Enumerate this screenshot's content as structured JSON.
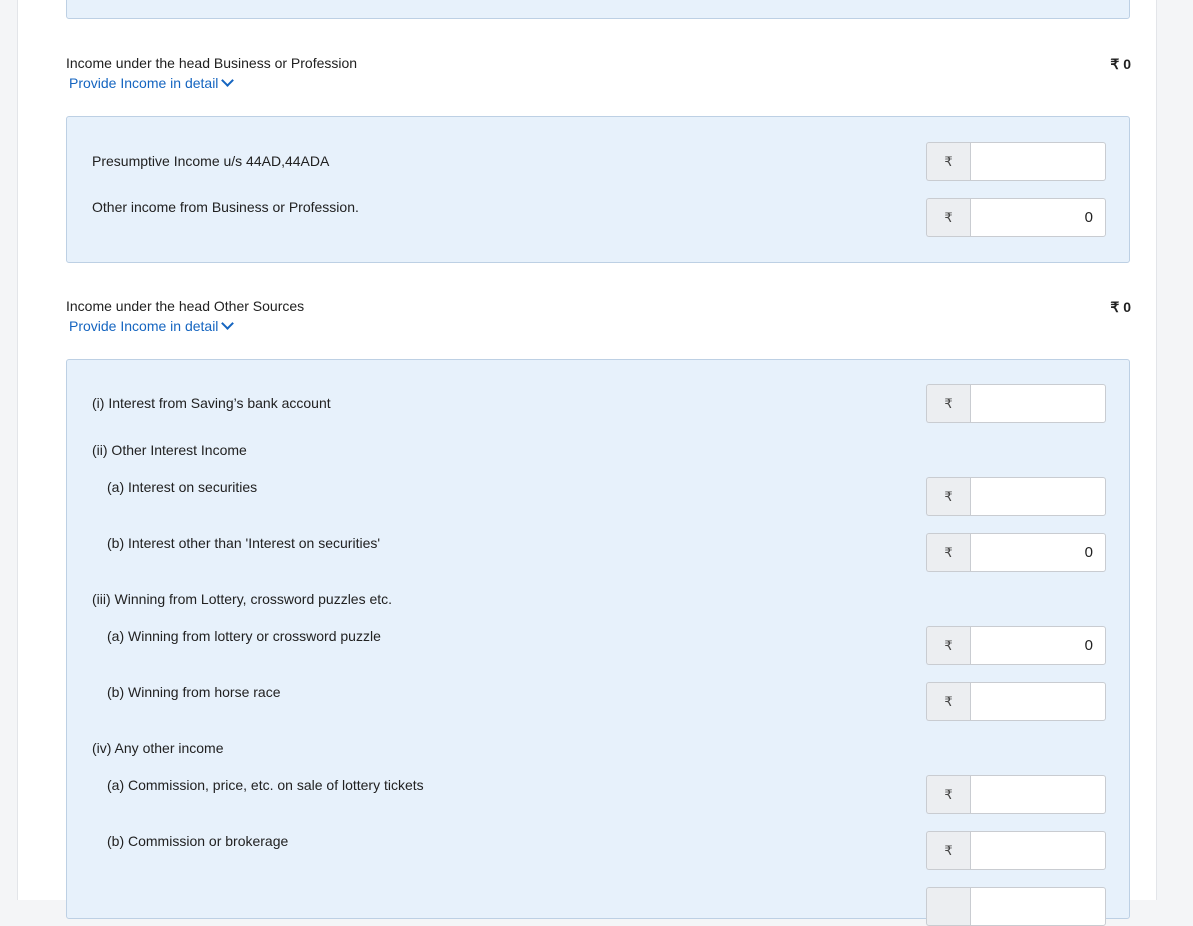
{
  "currency_symbol": "₹",
  "business": {
    "title": "Income under the head Business or Profession",
    "amount": "₹ 0",
    "link": "Provide Income in detail",
    "rows": [
      {
        "label": "Presumptive Income u/s 44AD,44ADA",
        "value": ""
      },
      {
        "label": "Other income from Business or Profession.",
        "value": "0"
      }
    ]
  },
  "other_sources": {
    "title": "Income under the head Other Sources",
    "amount": "₹ 0",
    "link": "Provide Income in detail",
    "savings": {
      "label": "(i) Interest from Saving’s bank account",
      "value": ""
    },
    "other_interest": {
      "label": "(ii) Other Interest Income",
      "securities": {
        "label": "(a) Interest on securities",
        "value": ""
      },
      "other_than": {
        "label": "(b) Interest other than 'Interest on securities'",
        "value": "0"
      }
    },
    "winnings": {
      "label": "(iii) Winning from Lottery, crossword puzzles etc.",
      "lottery": {
        "label": "(a) Winning from lottery or crossword puzzle",
        "value": "0"
      },
      "horse_race": {
        "label": "(b) Winning from horse race",
        "value": ""
      }
    },
    "any_other": {
      "label": "(iv) Any other income",
      "commission_lottery": {
        "label": "(a) Commission, price, etc. on sale of lottery tickets",
        "value": ""
      },
      "brokerage": {
        "label": "(b) Commission or brokerage",
        "value": ""
      }
    }
  }
}
